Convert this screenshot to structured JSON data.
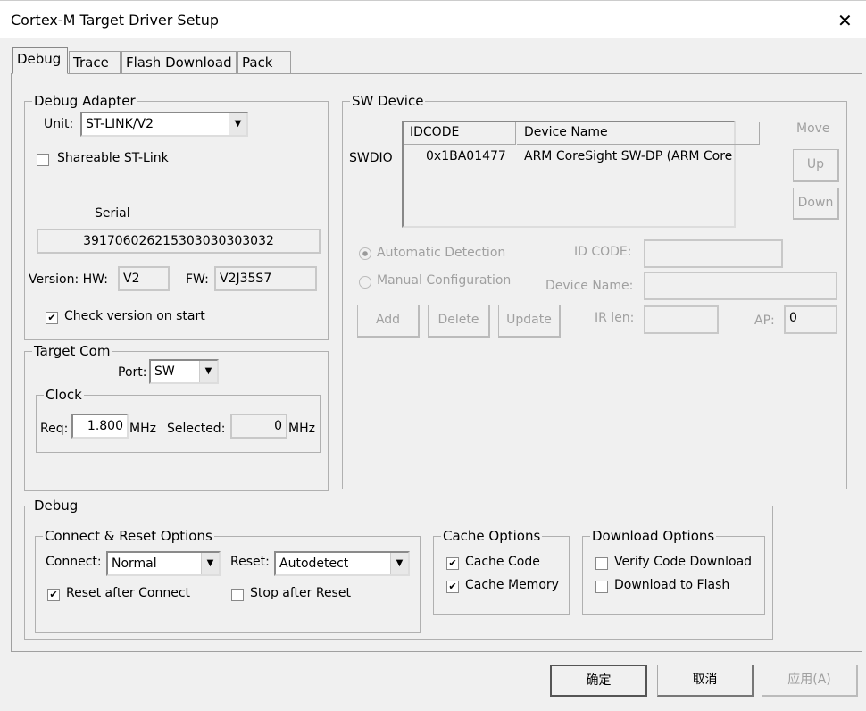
{
  "window": {
    "title": "Cortex-M Target Driver Setup",
    "close": "✕"
  },
  "tabs": [
    {
      "label": "Debug"
    },
    {
      "label": "Trace"
    },
    {
      "label": "Flash Download"
    },
    {
      "label": "Pack"
    }
  ],
  "debug_adapter": {
    "legend": "Debug Adapter",
    "unit_label": "Unit:",
    "unit_value": "ST-LINK/V2",
    "shareable_label": "Shareable ST-Link",
    "shareable_checked": false,
    "serial_label": "Serial",
    "serial_value": "391706026215303030303032",
    "version_label": "Version: HW:",
    "hw_value": "V2",
    "fw_label": "FW:",
    "fw_value": "V2J35S7",
    "check_version_label": "Check version on start",
    "check_version_checked": true
  },
  "target_com": {
    "legend": "Target Com",
    "port_label": "Port:",
    "port_value": "SW",
    "clock_legend": "Clock",
    "req_label": "Req:",
    "req_value": "1.800",
    "req_unit": "MHz",
    "selected_label": "Selected:",
    "selected_value": "0",
    "selected_unit": "MHz"
  },
  "sw_device": {
    "legend": "SW Device",
    "row_label": "SWDIO",
    "columns": [
      "IDCODE",
      "Device Name"
    ],
    "rows": [
      {
        "idcode": "0x1BA01477",
        "name": "ARM CoreSight SW-DP (ARM Core"
      }
    ],
    "move_label": "Move",
    "up": "Up",
    "down": "Down",
    "auto_detect": "Automatic Detection",
    "manual_config": "Manual Configuration",
    "auto_selected": true,
    "id_code_label": "ID CODE:",
    "device_name_label": "Device Name:",
    "ir_len_label": "IR len:",
    "ap_label": "AP:",
    "ap_value": "0",
    "add": "Add",
    "delete": "Delete",
    "update": "Update"
  },
  "debug": {
    "legend": "Debug",
    "connect_reset": {
      "legend": "Connect & Reset Options",
      "connect_label": "Connect:",
      "connect_value": "Normal",
      "reset_label": "Reset:",
      "reset_value": "Autodetect",
      "reset_after_connect": "Reset after Connect",
      "reset_after_connect_checked": true,
      "stop_after_reset": "Stop after Reset",
      "stop_after_reset_checked": false
    },
    "cache": {
      "legend": "Cache Options",
      "cache_code": "Cache Code",
      "cache_code_checked": true,
      "cache_memory": "Cache Memory",
      "cache_memory_checked": true
    },
    "download": {
      "legend": "Download Options",
      "verify": "Verify Code Download",
      "verify_checked": false,
      "to_flash": "Download to Flash",
      "to_flash_checked": false
    }
  },
  "buttons": {
    "ok": "确定",
    "cancel": "取消",
    "apply": "应用(A)"
  },
  "check_glyph": "✔"
}
